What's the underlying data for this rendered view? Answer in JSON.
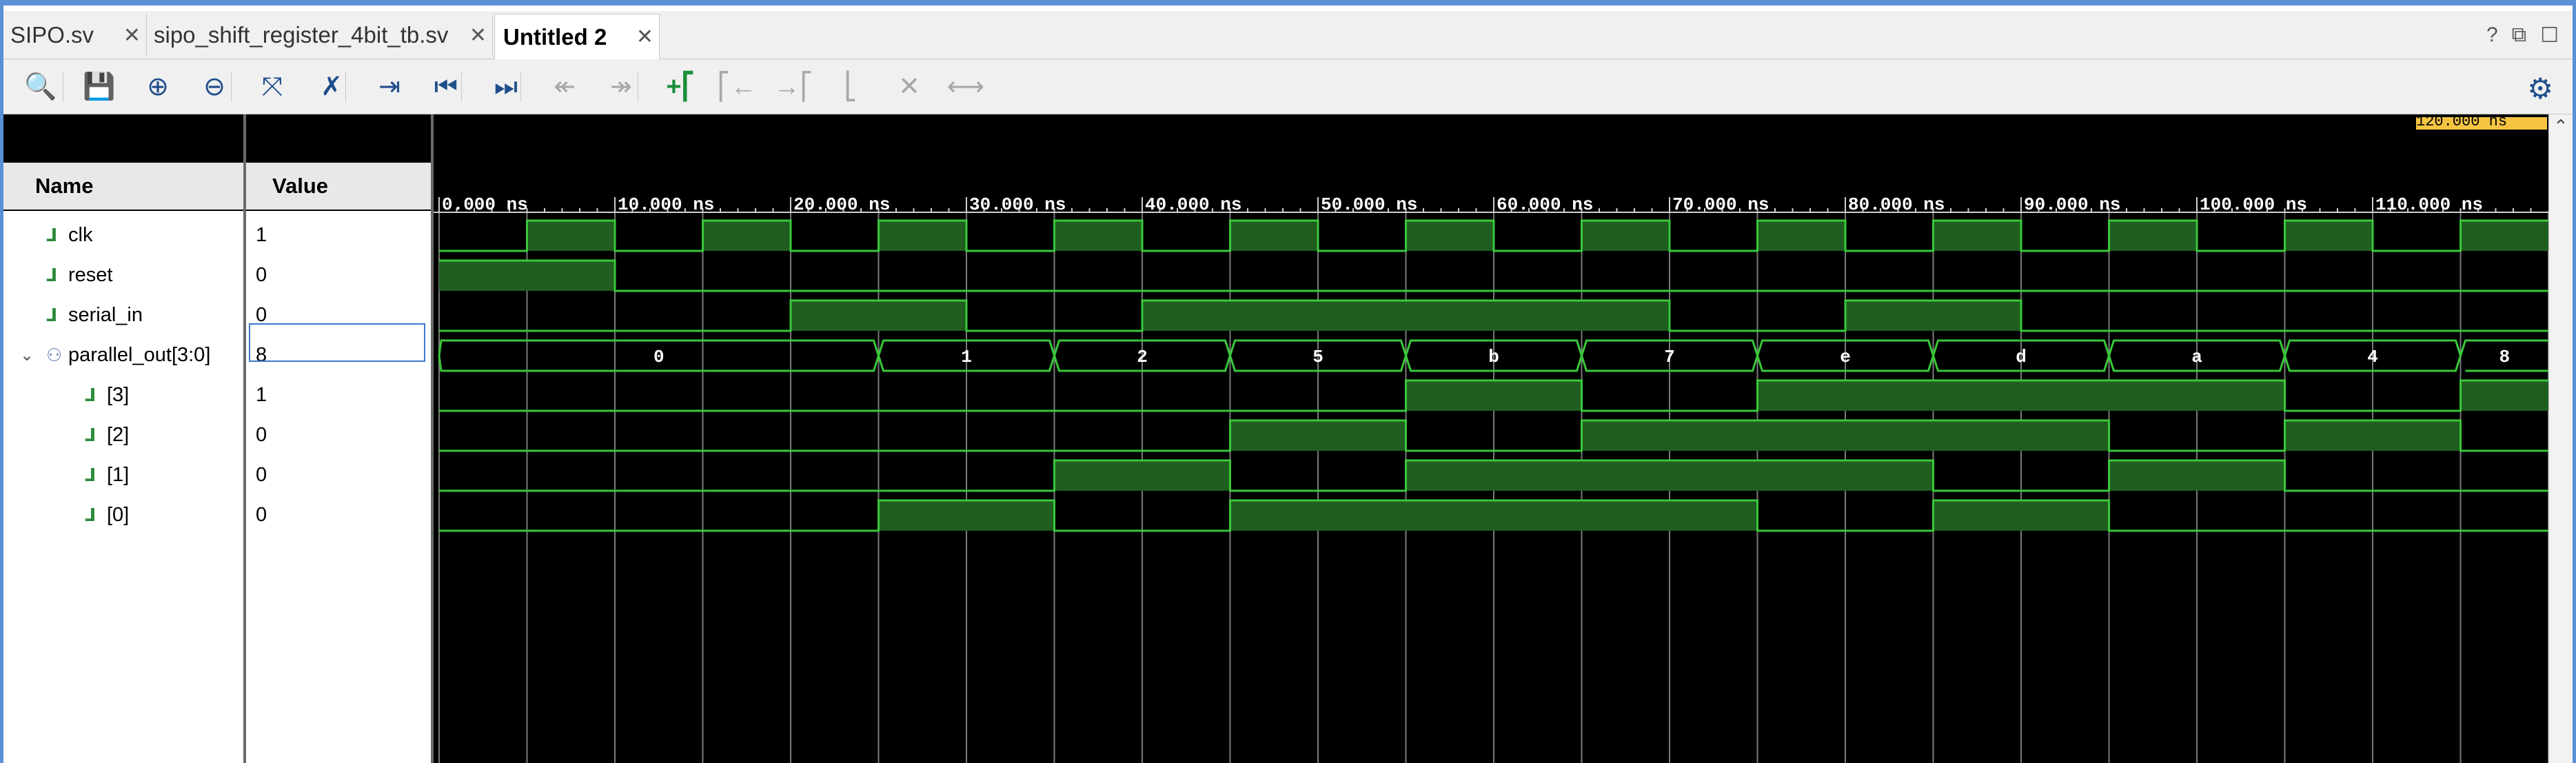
{
  "tabs": [
    {
      "label": "SIPO.sv",
      "closable": true,
      "active": false
    },
    {
      "label": "sipo_shift_register_4bit_tb.sv",
      "closable": true,
      "active": false
    },
    {
      "label": "Untitled 2",
      "closable": true,
      "active": true
    }
  ],
  "window_controls": [
    "?",
    "restore",
    "maximize"
  ],
  "toolbar": {
    "buttons": [
      {
        "name": "search-icon",
        "glyph": "🔍",
        "state": "active"
      },
      {
        "name": "save-icon",
        "glyph": "💾",
        "state": "active"
      },
      {
        "name": "zoom-in-icon",
        "glyph": "⊕",
        "state": "active"
      },
      {
        "name": "zoom-out-icon",
        "glyph": "⊖",
        "state": "active"
      },
      {
        "name": "zoom-fit-icon",
        "glyph": "⤧",
        "state": "active"
      },
      {
        "name": "snap-cursor-icon",
        "glyph": "✗",
        "state": "active"
      },
      {
        "name": "go-to-cursor-icon",
        "glyph": "⇥",
        "state": "active"
      },
      {
        "name": "go-to-time-0-icon",
        "glyph": "⏮",
        "state": "active"
      },
      {
        "name": "go-to-last-time-icon",
        "glyph": "⏭",
        "state": "active"
      },
      {
        "name": "previous-transition-icon",
        "glyph": "↞",
        "state": "disabled"
      },
      {
        "name": "next-transition-icon",
        "glyph": "↠",
        "state": "disabled"
      },
      {
        "name": "add-marker-icon",
        "glyph": "+⎡",
        "state": "green"
      },
      {
        "name": "previous-marker-icon",
        "glyph": "⎡←",
        "state": "disabled"
      },
      {
        "name": "next-marker-icon",
        "glyph": "→⎡",
        "state": "disabled"
      },
      {
        "name": "swap-cursors-icon",
        "glyph": "⎣",
        "state": "disabled"
      },
      {
        "name": "delete-marker-icon",
        "glyph": "✕",
        "state": "disabled"
      },
      {
        "name": "fit-markers-icon",
        "glyph": "⟷",
        "state": "disabled"
      }
    ],
    "settings_icon": "gear-icon"
  },
  "columns": {
    "name": "Name",
    "value": "Value"
  },
  "signals": [
    {
      "name": "clk",
      "value": "1",
      "indent": 0,
      "type": "bit",
      "expandable": false
    },
    {
      "name": "reset",
      "value": "0",
      "indent": 0,
      "type": "bit",
      "expandable": false
    },
    {
      "name": "serial_in",
      "value": "0",
      "indent": 0,
      "type": "bit",
      "expandable": false
    },
    {
      "name": "parallel_out[3:0]",
      "value": "8",
      "indent": 0,
      "type": "bus",
      "expandable": true
    },
    {
      "name": "[3]",
      "value": "1",
      "indent": 1,
      "type": "bit",
      "expandable": false
    },
    {
      "name": "[2]",
      "value": "0",
      "indent": 1,
      "type": "bit",
      "expandable": false
    },
    {
      "name": "[1]",
      "value": "0",
      "indent": 1,
      "type": "bit",
      "expandable": false
    },
    {
      "name": "[0]",
      "value": "0",
      "indent": 1,
      "type": "bit",
      "expandable": false
    }
  ],
  "timeline": {
    "unit": "ns",
    "tick_labels": [
      "0.000 ns",
      "10.000 ns",
      "20.000 ns",
      "30.000 ns",
      "40.000 ns",
      "50.000 ns",
      "60.000 ns",
      "70.000 ns",
      "80.000 ns",
      "90.000 ns",
      "100.000 ns",
      "110.000 ns"
    ],
    "tick_times": [
      0,
      10,
      20,
      30,
      40,
      50,
      60,
      70,
      80,
      90,
      100,
      110
    ],
    "visible_end_ns": 120,
    "cursor_label": "120.000 ns",
    "grid_step_ns": 5
  },
  "waveforms": {
    "clk": [
      [
        0,
        0
      ],
      [
        5,
        1
      ],
      [
        10,
        0
      ],
      [
        15,
        1
      ],
      [
        20,
        0
      ],
      [
        25,
        1
      ],
      [
        30,
        0
      ],
      [
        35,
        1
      ],
      [
        40,
        0
      ],
      [
        45,
        1
      ],
      [
        50,
        0
      ],
      [
        55,
        1
      ],
      [
        60,
        0
      ],
      [
        65,
        1
      ],
      [
        70,
        0
      ],
      [
        75,
        1
      ],
      [
        80,
        0
      ],
      [
        85,
        1
      ],
      [
        90,
        0
      ],
      [
        95,
        1
      ],
      [
        100,
        0
      ],
      [
        105,
        1
      ],
      [
        110,
        0
      ],
      [
        115,
        1
      ],
      [
        120,
        0
      ]
    ],
    "reset": [
      [
        0,
        1
      ],
      [
        10,
        0
      ],
      [
        120,
        0
      ]
    ],
    "serial_in": [
      [
        0,
        0
      ],
      [
        20,
        1
      ],
      [
        30,
        0
      ],
      [
        40,
        1
      ],
      [
        70,
        0
      ],
      [
        80,
        1
      ],
      [
        90,
        0
      ],
      [
        120,
        0
      ]
    ],
    "parallel_out": [
      {
        "start": 0,
        "end": 25,
        "label": "0"
      },
      {
        "start": 25,
        "end": 35,
        "label": "1"
      },
      {
        "start": 35,
        "end": 45,
        "label": "2"
      },
      {
        "start": 45,
        "end": 55,
        "label": "5"
      },
      {
        "start": 55,
        "end": 65,
        "label": "b"
      },
      {
        "start": 65,
        "end": 75,
        "label": "7"
      },
      {
        "start": 75,
        "end": 85,
        "label": "e"
      },
      {
        "start": 85,
        "end": 95,
        "label": "d"
      },
      {
        "start": 95,
        "end": 105,
        "label": "a"
      },
      {
        "start": 105,
        "end": 115,
        "label": "4"
      },
      {
        "start": 115,
        "end": 120,
        "label": "8"
      }
    ],
    "bit3": [
      [
        0,
        0
      ],
      [
        55,
        1
      ],
      [
        65,
        0
      ],
      [
        75,
        1
      ],
      [
        105,
        0
      ],
      [
        115,
        1
      ],
      [
        120,
        1
      ]
    ],
    "bit2": [
      [
        0,
        0
      ],
      [
        45,
        1
      ],
      [
        55,
        0
      ],
      [
        65,
        1
      ],
      [
        95,
        0
      ],
      [
        105,
        1
      ],
      [
        115,
        0
      ],
      [
        120,
        0
      ]
    ],
    "bit1": [
      [
        0,
        0
      ],
      [
        35,
        1
      ],
      [
        45,
        0
      ],
      [
        55,
        1
      ],
      [
        85,
        0
      ],
      [
        95,
        1
      ],
      [
        105,
        0
      ],
      [
        120,
        0
      ]
    ],
    "bit0": [
      [
        0,
        0
      ],
      [
        25,
        1
      ],
      [
        35,
        0
      ],
      [
        45,
        1
      ],
      [
        75,
        0
      ],
      [
        85,
        1
      ],
      [
        95,
        0
      ],
      [
        120,
        0
      ]
    ]
  },
  "colors": {
    "wave_line": "#39c839",
    "wave_fill": "#1f5e1f",
    "grid": "#7a7a7a",
    "ruler_text": "#ffffff",
    "wave_background": "#000000"
  }
}
